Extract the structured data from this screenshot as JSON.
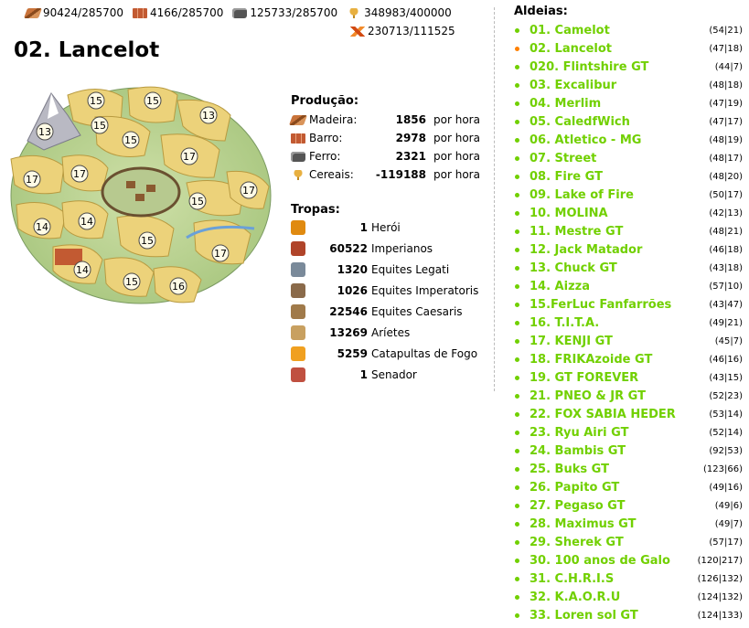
{
  "resources": {
    "wood": {
      "icon": "wood-icon",
      "value": "90424/285700"
    },
    "clay": {
      "icon": "clay-icon",
      "value": "4166/285700"
    },
    "iron": {
      "icon": "iron-icon",
      "value": "125733/285700"
    },
    "crop": {
      "icon": "crop-icon",
      "value": "348983/400000"
    },
    "consumption": {
      "icon": "crop-consumption-icon",
      "value": "230713/111525"
    }
  },
  "village_title": "02. Lancelot",
  "map": {
    "fields": [
      "15",
      "15",
      "13",
      "13",
      "15",
      "15",
      "17",
      "17",
      "17",
      "17",
      "15",
      "14",
      "14",
      "15",
      "17",
      "14",
      "15",
      "16"
    ]
  },
  "production": {
    "title": "Produção:",
    "rows": [
      {
        "icon": "wood-icon",
        "name": "Madeira:",
        "value": "1856",
        "unit": "por hora"
      },
      {
        "icon": "clay-icon",
        "name": "Barro:",
        "value": "2978",
        "unit": "por hora"
      },
      {
        "icon": "iron-icon",
        "name": "Ferro:",
        "value": "2321",
        "unit": "por hora"
      },
      {
        "icon": "crop-icon",
        "name": "Cereais:",
        "value": "-119188",
        "unit": "por hora"
      }
    ]
  },
  "troops": {
    "title": "Tropas:",
    "rows": [
      {
        "icon": "hero-icon",
        "count": "1",
        "name": "Herói",
        "color": "#e08a10"
      },
      {
        "icon": "imperian-icon",
        "count": "60522",
        "name": "Imperianos",
        "color": "#b0442a"
      },
      {
        "icon": "equites-legati-icon",
        "count": "1320",
        "name": "Equites Legati",
        "color": "#7a8a9a"
      },
      {
        "icon": "equites-imperatoris-icon",
        "count": "1026",
        "name": "Equites Imperatoris",
        "color": "#8a6a4a"
      },
      {
        "icon": "equites-caesaris-icon",
        "count": "22546",
        "name": "Equites Caesaris",
        "color": "#a07a4a"
      },
      {
        "icon": "ram-icon",
        "count": "13269",
        "name": "Aríetes",
        "color": "#c8a060"
      },
      {
        "icon": "fire-catapult-icon",
        "count": "5259",
        "name": "Catapultas de Fogo",
        "color": "#f0a020"
      },
      {
        "icon": "senator-icon",
        "count": "1",
        "name": "Senador",
        "color": "#c05040"
      }
    ]
  },
  "villages": {
    "title": "Aldeias:",
    "active_color": "#ff8000",
    "link_color": "#71d000",
    "items": [
      {
        "name": "01. Camelot",
        "coords": "(54|21)"
      },
      {
        "name": "02. Lancelot",
        "coords": "(47|18)",
        "active": true
      },
      {
        "name": "020. Flintshire GT",
        "coords": "(44|7)"
      },
      {
        "name": "03. Excalibur",
        "coords": "(48|18)"
      },
      {
        "name": "04. Merlim",
        "coords": "(47|19)"
      },
      {
        "name": "05. CaledfWich",
        "coords": "(47|17)"
      },
      {
        "name": "06. Atletico - MG",
        "coords": "(48|19)"
      },
      {
        "name": "07. Street",
        "coords": "(48|17)"
      },
      {
        "name": "08. Fire GT",
        "coords": "(48|20)"
      },
      {
        "name": "09. Lake of Fire",
        "coords": "(50|17)"
      },
      {
        "name": "10. MOLINA",
        "coords": "(42|13)"
      },
      {
        "name": "11. Mestre GT",
        "coords": "(48|21)"
      },
      {
        "name": "12. Jack Matador",
        "coords": "(46|18)"
      },
      {
        "name": "13. Chuck GT",
        "coords": "(43|18)"
      },
      {
        "name": "14. Aizza",
        "coords": "(57|10)"
      },
      {
        "name": "15.FerLuc Fanfarrões",
        "coords": "(43|47)"
      },
      {
        "name": "16. T.I.T.A.",
        "coords": "(49|21)"
      },
      {
        "name": "17. KENJI GT",
        "coords": "(45|7)"
      },
      {
        "name": "18. FRIKAzoide GT",
        "coords": "(46|16)"
      },
      {
        "name": "19. GT FOREVER",
        "coords": "(43|15)"
      },
      {
        "name": "21. PNEO & JR GT",
        "coords": "(52|23)"
      },
      {
        "name": "22. FOX SABIA HEDER",
        "coords": "(53|14)"
      },
      {
        "name": "23. Ryu Airi GT",
        "coords": "(52|14)"
      },
      {
        "name": "24. Bambis GT",
        "coords": "(92|53)"
      },
      {
        "name": "25. Buks GT",
        "coords": "(123|66)"
      },
      {
        "name": "26. Papito GT",
        "coords": "(49|16)"
      },
      {
        "name": "27. Pegaso GT",
        "coords": "(49|6)"
      },
      {
        "name": "28. Maximus GT",
        "coords": "(49|7)"
      },
      {
        "name": "29. Sherek GT",
        "coords": "(57|17)"
      },
      {
        "name": "30. 100 anos de Galo",
        "coords": "(120|217)"
      },
      {
        "name": "31. C.H.R.I.S",
        "coords": "(126|132)"
      },
      {
        "name": "32. K.A.O.R.U",
        "coords": "(124|132)"
      },
      {
        "name": "33. Loren sol GT",
        "coords": "(124|133)"
      }
    ]
  }
}
